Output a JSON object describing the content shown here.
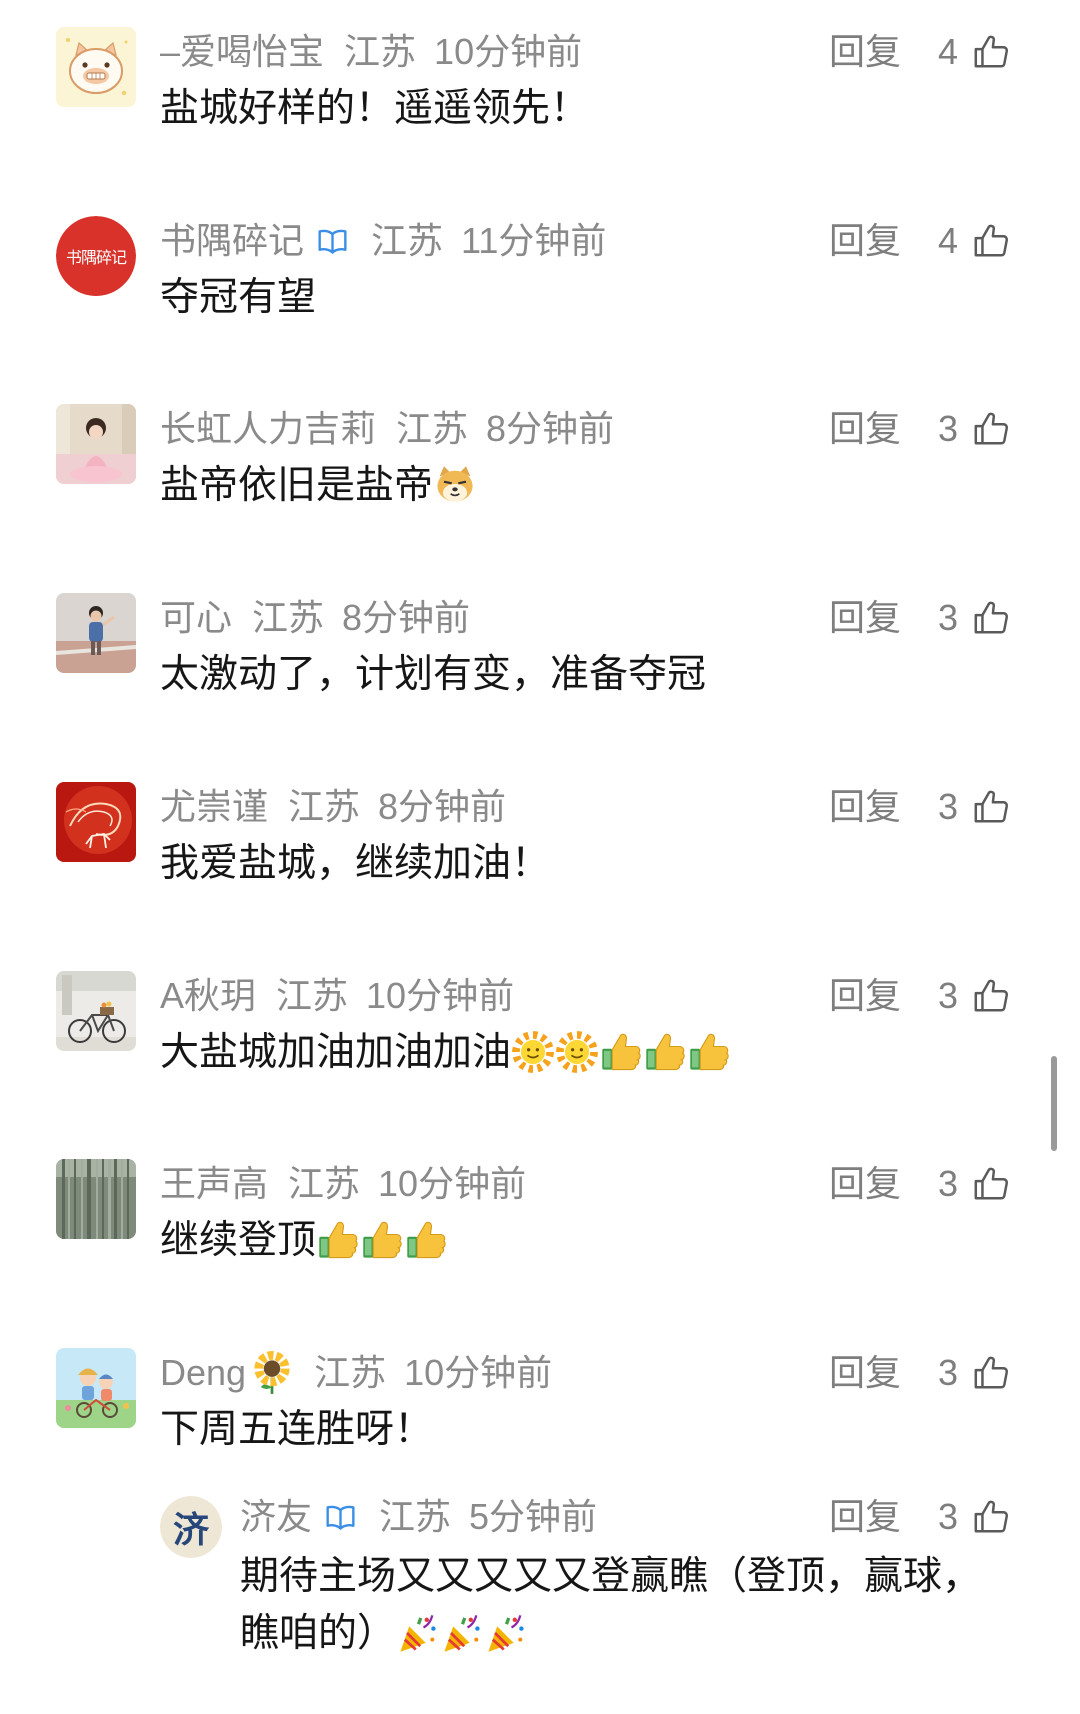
{
  "ui": {
    "reply_label": "回复"
  },
  "colors": {
    "meta_text": "#8a8a8a",
    "body_text": "#161616",
    "verified_badge": "#3a8ee6",
    "scrollbar": "#9a9a9a"
  },
  "comments": [
    {
      "name": "–爱喝怡宝",
      "location": "江苏",
      "time": "10分钟前",
      "likes": "4",
      "text": "盐城好样的！遥遥领先！",
      "emojis": [],
      "avatar_icon": "pig-cartoon-avatar"
    },
    {
      "name": "书隅碎记",
      "badge_icon": "verified-icon",
      "location": "江苏",
      "time": "11分钟前",
      "likes": "4",
      "text": "夺冠有望",
      "emojis": [],
      "avatar_icon": "red-logo-avatar",
      "avatar_logo_text": "书隅碎记"
    },
    {
      "name": "长虹人力吉莉",
      "location": "江苏",
      "time": "8分钟前",
      "likes": "3",
      "text": "盐帝依旧是盐帝",
      "emojis": [
        "doge"
      ],
      "avatar_icon": "girl-photo-avatar"
    },
    {
      "name": "可心",
      "location": "江苏",
      "time": "8分钟前",
      "likes": "3",
      "text": "太激动了，计划有变，准备夺冠",
      "emojis": [],
      "avatar_icon": "child-photo-avatar"
    },
    {
      "name": "尤崇谨",
      "location": "江苏",
      "time": "8分钟前",
      "likes": "3",
      "text": "我爱盐城，继续加油！",
      "emojis": [],
      "avatar_icon": "red-horse-avatar"
    },
    {
      "name": "A秋玥",
      "location": "江苏",
      "time": "10分钟前",
      "likes": "3",
      "text": "大盐城加油加油加油",
      "emojis": [
        "sun-with-face",
        "sun-with-face",
        "thumbs-up",
        "thumbs-up",
        "thumbs-up"
      ],
      "avatar_icon": "bicycle-photo-avatar"
    },
    {
      "name": "王声高",
      "location": "江苏",
      "time": "10分钟前",
      "likes": "3",
      "text": "继续登顶",
      "emojis": [
        "thumbs-up",
        "thumbs-up",
        "thumbs-up"
      ],
      "avatar_icon": "bamboo-photo-avatar"
    },
    {
      "name": "Deng",
      "name_emoji": "sunflower",
      "location": "江苏",
      "time": "10分钟前",
      "likes": "3",
      "text": "下周五连胜呀！",
      "emojis": [],
      "avatar_icon": "cartoon-kids-avatar"
    }
  ],
  "reply": {
    "name": "济友",
    "badge_icon": "verified-icon",
    "location": "江苏",
    "time": "5分钟前",
    "likes": "3",
    "text": "期待主场又又又又又登赢瞧（登顶，赢球，瞧咱的）",
    "emojis": [
      "party-popper",
      "party-popper",
      "party-popper"
    ],
    "avatar_icon": "ji-logo-avatar",
    "avatar_logo_text": "济"
  }
}
